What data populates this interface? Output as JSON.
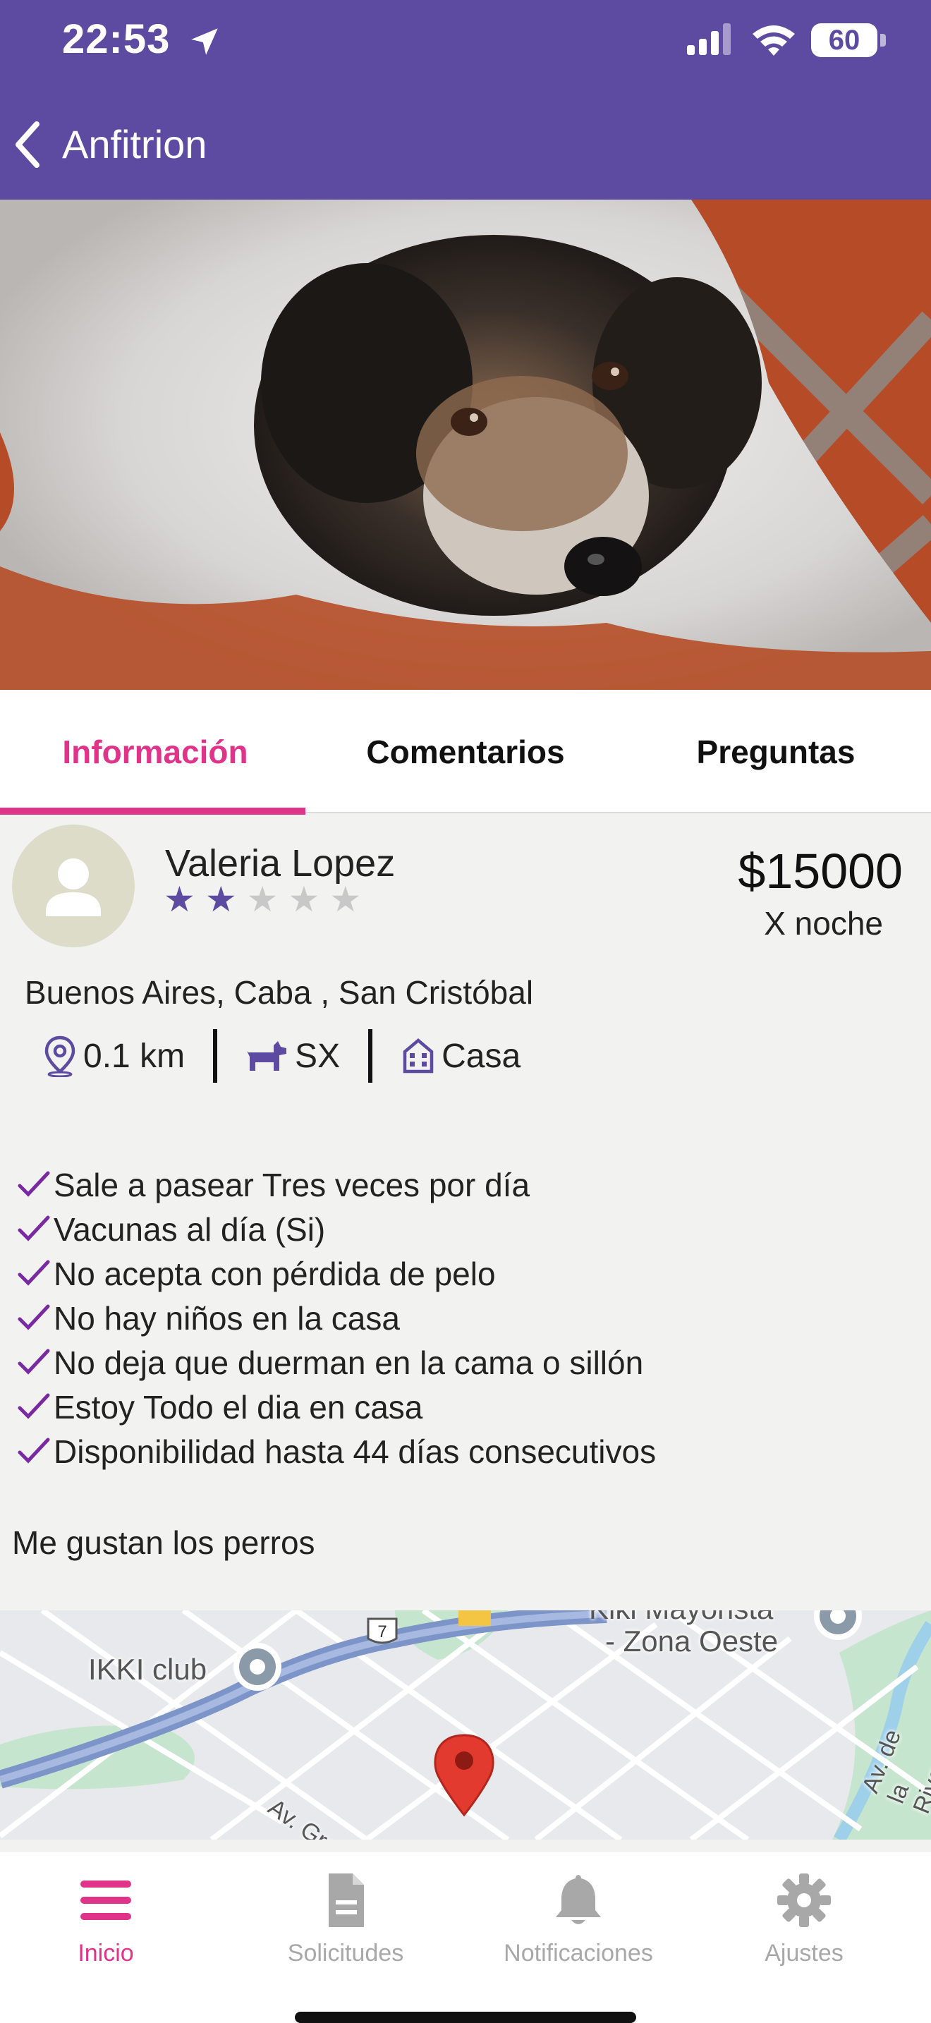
{
  "status_bar": {
    "time": "22:53",
    "battery": "60"
  },
  "header": {
    "title": "Anfitrion"
  },
  "tabs": [
    {
      "label": "Información",
      "active": true
    },
    {
      "label": "Comentarios",
      "active": false
    },
    {
      "label": "Preguntas",
      "active": false
    }
  ],
  "host": {
    "name": "Valeria Lopez",
    "rating": 2,
    "rating_max": 5,
    "price": "$15000",
    "price_unit": "X noche",
    "address": "Buenos Aires, Caba , San Cristóbal",
    "distance": "0.1 km",
    "dog_size": "SX",
    "home_type": "Casa"
  },
  "features": [
    "Sale a pasear Tres veces por día",
    "Vacunas al día (Si)",
    "No acepta con pérdida de pelo",
    "No hay niños en la casa",
    "No deja que duerman en la cama o sillón",
    "Estoy Todo el dia en casa",
    "Disponibilidad hasta 44 días consecutivos"
  ],
  "description": "Me gustan los perros",
  "map": {
    "labels": {
      "place_1": "IKKI club",
      "place_2": "- Zona Oeste",
      "place_2_top": "Kiki Mayorista",
      "street_1": "Av. Gral.",
      "street_2": "Av. de la Rivera",
      "route": "7"
    }
  },
  "bottom_nav": [
    {
      "label": "Inicio",
      "icon": "menu-icon",
      "active": true
    },
    {
      "label": "Solicitudes",
      "icon": "document-icon",
      "active": false
    },
    {
      "label": "Notificaciones",
      "icon": "bell-icon",
      "active": false
    },
    {
      "label": "Ajustes",
      "icon": "gear-icon",
      "active": false
    }
  ],
  "colors": {
    "header": "#5c4ba0",
    "accent": "#e0338a",
    "star": "#5c4ba0",
    "check": "#7a2aa0"
  }
}
